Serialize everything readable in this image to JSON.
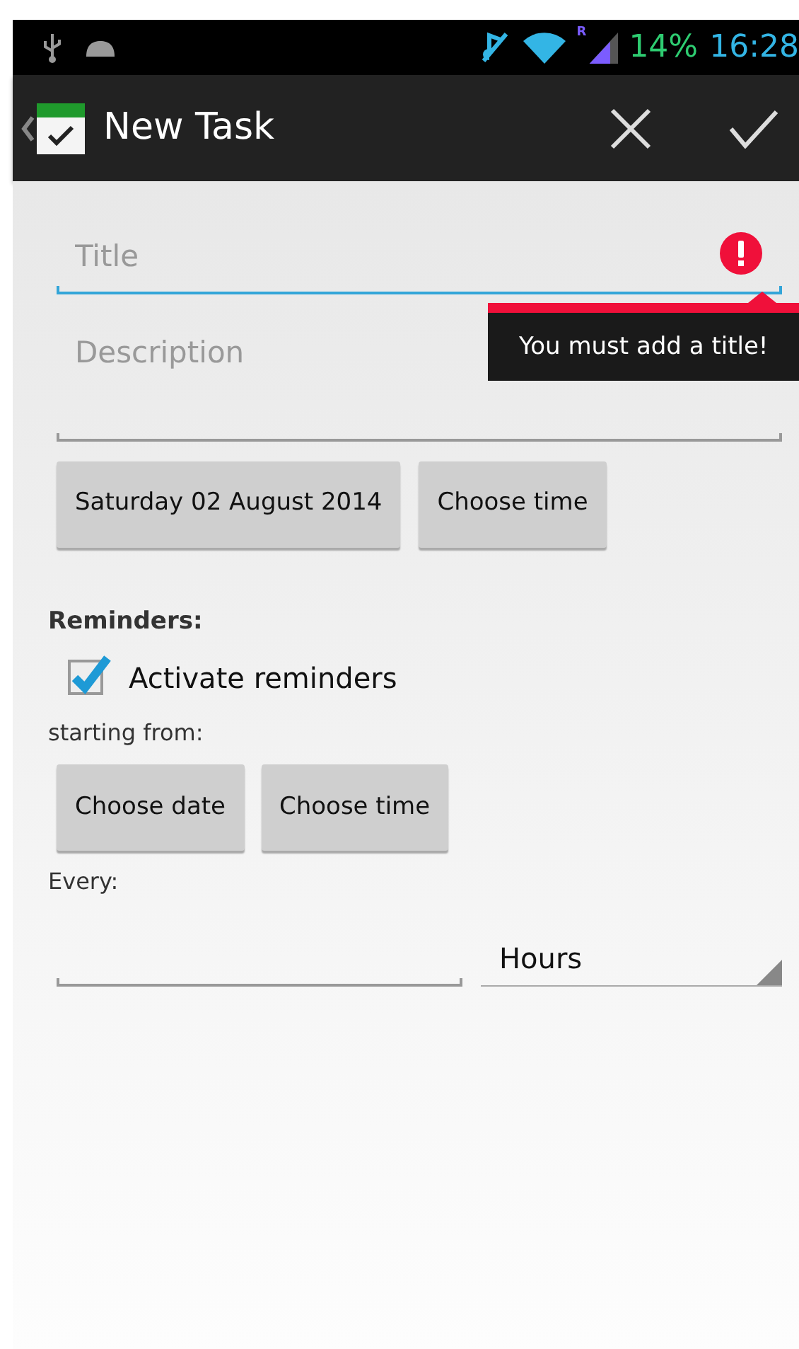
{
  "status_bar": {
    "roaming": "R",
    "battery": "14%",
    "time": "16:28"
  },
  "action_bar": {
    "title": "New Task"
  },
  "task": {
    "title": {
      "placeholder": "Title",
      "focused": true,
      "error": "You must add a title!"
    },
    "description": {
      "placeholder": "Description"
    },
    "date_button": "Saturday 02 August 2014",
    "time_button": "Choose time"
  },
  "reminders": {
    "heading": "Reminders:",
    "activate": {
      "label": "Activate reminders",
      "checked": true
    },
    "starting_label": "starting from:",
    "buttons": [
      "Choose date",
      "Choose time"
    ],
    "every_label": "Every:",
    "unit": "Hours"
  }
}
